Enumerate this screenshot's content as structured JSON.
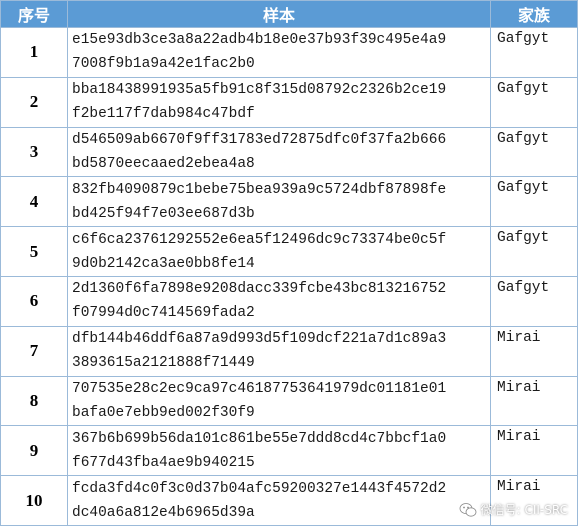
{
  "headers": {
    "index": "序号",
    "sample": "样本",
    "family": "家族"
  },
  "rows": [
    {
      "index": "1",
      "hash_line1": "e15e93db3ce3a8a22adb4b18e0e37b93f39c495e4a9",
      "hash_line2": "7008f9b1a9a42e1fac2b0",
      "family": "Gafgyt"
    },
    {
      "index": "2",
      "hash_line1": "bba18438991935a5fb91c8f315d08792c2326b2ce19",
      "hash_line2": "f2be117f7dab984c47bdf",
      "family": "Gafgyt"
    },
    {
      "index": "3",
      "hash_line1": "d546509ab6670f9ff31783ed72875dfc0f37fa2b666",
      "hash_line2": "bd5870eecaaed2ebea4a8",
      "family": "Gafgyt"
    },
    {
      "index": "4",
      "hash_line1": "832fb4090879c1bebe75bea939a9c5724dbf87898fe",
      "hash_line2": "bd425f94f7e03ee687d3b",
      "family": "Gafgyt"
    },
    {
      "index": "5",
      "hash_line1": "c6f6ca23761292552e6ea5f12496dc9c73374be0c5f",
      "hash_line2": "9d0b2142ca3ae0bb8fe14",
      "family": "Gafgyt"
    },
    {
      "index": "6",
      "hash_line1": "2d1360f6fa7898e9208dacc339fcbe43bc813216752",
      "hash_line2": "f07994d0c7414569fada2",
      "family": "Gafgyt"
    },
    {
      "index": "7",
      "hash_line1": "dfb144b46ddf6a87a9d993d5f109dcf221a7d1c89a3",
      "hash_line2": "3893615a2121888f71449",
      "family": "Mirai"
    },
    {
      "index": "8",
      "hash_line1": "707535e28c2ec9ca97c46187753641979dc01181e01",
      "hash_line2": "bafa0e7ebb9ed002f30f9",
      "family": "Mirai"
    },
    {
      "index": "9",
      "hash_line1": "367b6b699b56da101c861be55e7ddd8cd4c7bbcf1a0",
      "hash_line2": "f677d43fba4ae9b940215",
      "family": "Mirai"
    },
    {
      "index": "10",
      "hash_line1": "fcda3fd4c0f3c0d37b04afc59200327e1443f4572d2",
      "hash_line2": "dc40a6a812e4b6965d39a",
      "family": "Mirai"
    }
  ],
  "watermark": {
    "text": "微信号: CII-SRC",
    "icon": "wechat-icon"
  }
}
